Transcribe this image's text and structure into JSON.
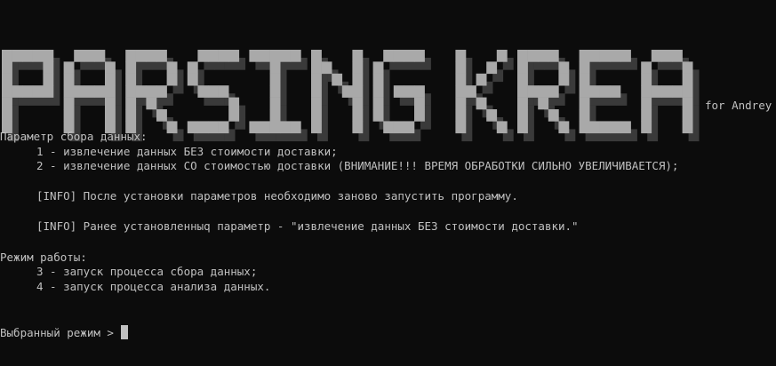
{
  "banner": {
    "title": "PARSING KREAM",
    "subtitle": "for Andrey"
  },
  "settings": {
    "heading": "Параметр сбора данных:",
    "options": [
      "1 - извлечение данных БЕЗ стоимости доставки;",
      "2 - извлечение данных СО стоимостью доставки (ВНИМАНИЕ!!! ВРЕМЯ ОБРАБОТКИ СИЛЬНО УВЕЛИЧИВАЕТСЯ);"
    ],
    "info_restart": "[INFO] После установки параметров необходимо заново запустить программу.",
    "info_current": "[INFO] Ранее установленныq параметр - \"извлечение данных БЕЗ стоимости доставки.\""
  },
  "mode": {
    "heading": "Режим работы:",
    "options": [
      "3 - запуск процесса сбора данных;",
      "4 - запуск процесса анализа данных."
    ]
  },
  "prompt": {
    "label": "Выбранный режим > "
  },
  "colors": {
    "background": "#0c0c0c",
    "text": "#c0c0c0",
    "banner_face": "#a9a9a9",
    "banner_shadow": "#3a3a3a"
  }
}
